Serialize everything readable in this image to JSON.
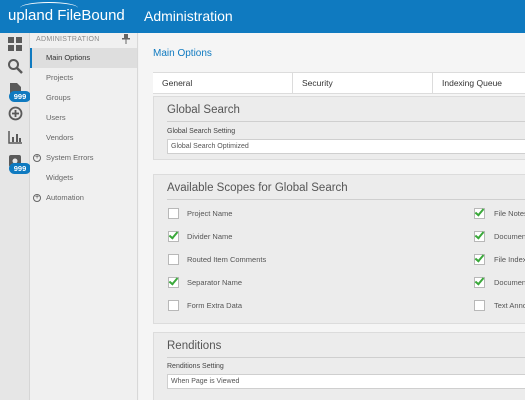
{
  "header": {
    "brand_left": "upland",
    "brand_right": "FileBound",
    "title": "Administration"
  },
  "rail": {
    "icons": [
      {
        "name": "dashboard-icon",
        "glyph": "▦"
      },
      {
        "name": "search-icon",
        "glyph": "🔍"
      },
      {
        "name": "document-icon",
        "glyph": "🗎"
      },
      {
        "name": "add-circle-icon",
        "glyph": "⊕"
      },
      {
        "name": "chart-icon",
        "glyph": "📈"
      },
      {
        "name": "workflow-icon",
        "glyph": "⚙"
      }
    ],
    "badges": [
      "999",
      "999"
    ]
  },
  "menu": {
    "header": "ADMINISTRATION",
    "items": [
      {
        "label": "Main Options",
        "active": true,
        "expandable": false
      },
      {
        "label": "Projects",
        "active": false,
        "expandable": false
      },
      {
        "label": "Groups",
        "active": false,
        "expandable": false
      },
      {
        "label": "Users",
        "active": false,
        "expandable": false
      },
      {
        "label": "Vendors",
        "active": false,
        "expandable": false
      },
      {
        "label": "System Errors",
        "active": false,
        "expandable": true
      },
      {
        "label": "Widgets",
        "active": false,
        "expandable": false
      },
      {
        "label": "Automation",
        "active": false,
        "expandable": true
      }
    ]
  },
  "main": {
    "title": "Main Options",
    "tabs": [
      "General",
      "Security",
      "Indexing Queue"
    ],
    "global_search": {
      "title": "Global Search",
      "setting_label": "Global Search Setting",
      "setting_value": "Global Search Optimized"
    },
    "scopes": {
      "title": "Available Scopes for Global Search",
      "left": [
        {
          "label": "Project Name",
          "checked": false
        },
        {
          "label": "Divider Name",
          "checked": true
        },
        {
          "label": "Routed Item Comments",
          "checked": false
        },
        {
          "label": "Separator Name",
          "checked": true
        },
        {
          "label": "Form Extra Data",
          "checked": false
        }
      ],
      "right": [
        {
          "label": "File Notes",
          "checked": true
        },
        {
          "label": "Documen",
          "checked": true
        },
        {
          "label": "File Index",
          "checked": true
        },
        {
          "label": "Documen",
          "checked": true
        },
        {
          "label": "Text Anno",
          "checked": false
        }
      ]
    },
    "renditions": {
      "title": "Renditions",
      "setting_label": "Renditions Setting",
      "setting_value": "When Page is Viewed"
    }
  },
  "colors": {
    "brand_blue": "#0f7ac0",
    "check_green": "#3aa83a"
  }
}
